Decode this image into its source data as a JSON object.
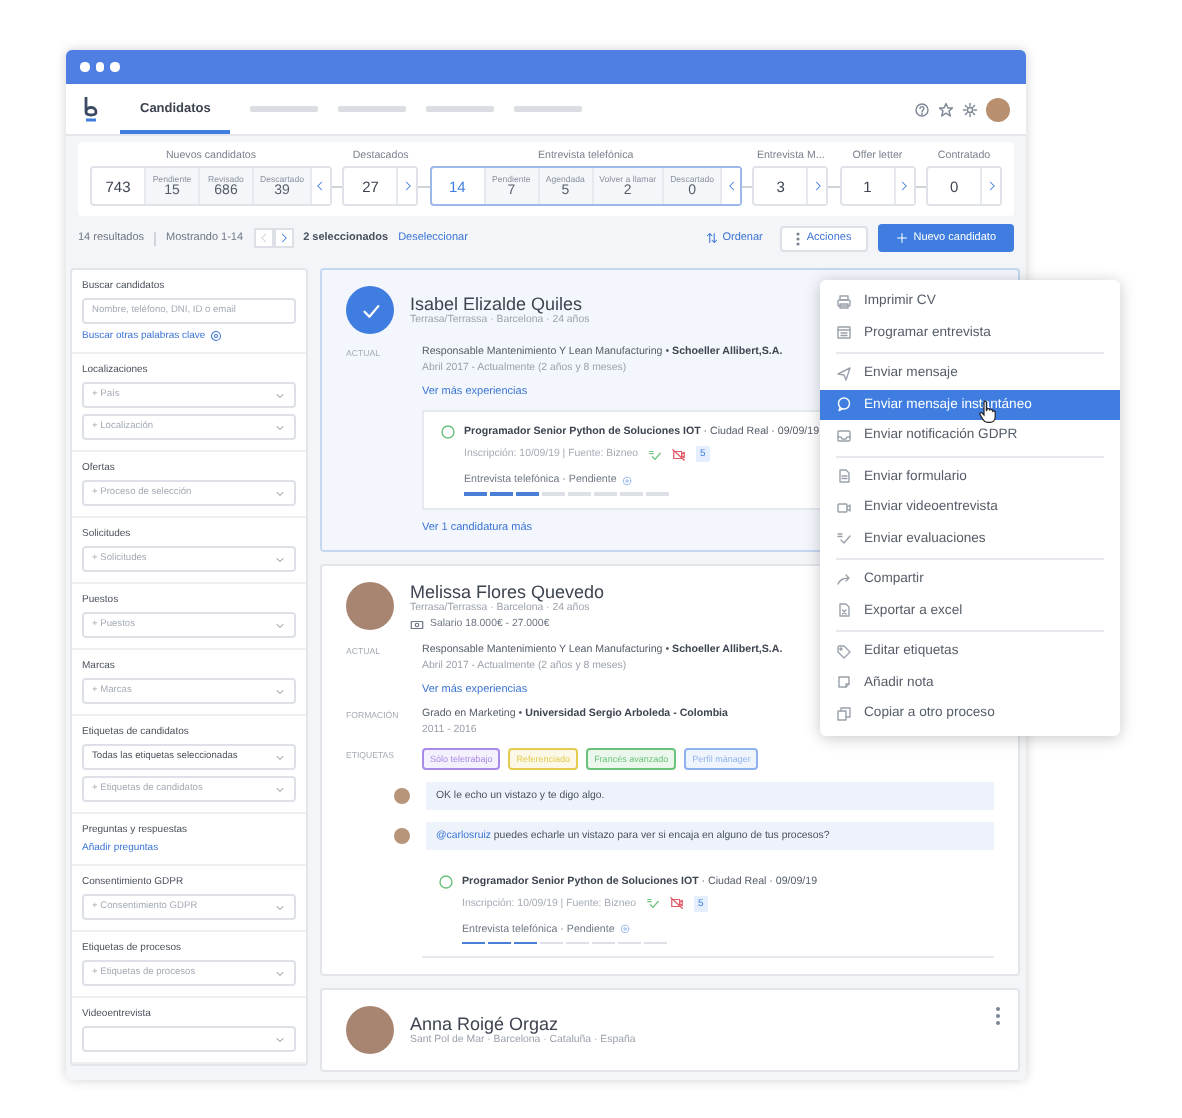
{
  "nav": {
    "tabs": [
      {
        "label": "Candidatos",
        "selected": true
      }
    ]
  },
  "pipeline": {
    "stages": [
      {
        "kind": "group",
        "title": "Nuevos candidatos",
        "total": "743",
        "selected": false,
        "subs": [
          {
            "label": "Pendiente",
            "count": "15"
          },
          {
            "label": "Revisado",
            "count": "686"
          },
          {
            "label": "Descartado",
            "count": "39"
          }
        ]
      },
      {
        "kind": "single",
        "title": "Destacados",
        "total": "27",
        "selected": false
      },
      {
        "kind": "group",
        "title": "Entrevista telefónica",
        "total": "14",
        "selected": true,
        "subs": [
          {
            "label": "Pendiente",
            "count": "7"
          },
          {
            "label": "Agendada",
            "count": "5"
          },
          {
            "label": "Volver a llamar",
            "count": "2"
          },
          {
            "label": "Descartado",
            "count": "0"
          }
        ]
      },
      {
        "kind": "single",
        "title": "Entrevista M...",
        "total": "3",
        "selected": false
      },
      {
        "kind": "single",
        "title": "Offer letter",
        "total": "1",
        "selected": false
      },
      {
        "kind": "single",
        "title": "Contratado",
        "total": "0",
        "selected": false
      }
    ]
  },
  "toolbar": {
    "results": "14 resultados",
    "showing": "Mostrando 1-14",
    "selected_count": "2 seleccionados",
    "deselect": "Deseleccionar",
    "sort": "Ordenar",
    "actions": "Acciones",
    "new_candidate": "Nuevo candidato"
  },
  "filters": [
    {
      "title": "Buscar candidatos",
      "fields": [
        {
          "kind": "input",
          "placeholder": "Nombre, teléfono, DNI, ID o email"
        }
      ],
      "link": {
        "text": "Buscar otras palabras clave",
        "kind": "help"
      }
    },
    {
      "title": "Localizaciones",
      "fields": [
        {
          "kind": "select",
          "placeholder": "+ País"
        },
        {
          "kind": "select",
          "placeholder": "+ Localización"
        }
      ]
    },
    {
      "title": "Ofertas",
      "fields": [
        {
          "kind": "select",
          "placeholder": "+ Proceso de selección"
        }
      ]
    },
    {
      "title": "Solicitudes",
      "fields": [
        {
          "kind": "select",
          "placeholder": "+ Solicitudes"
        }
      ]
    },
    {
      "title": "Puestos",
      "fields": [
        {
          "kind": "select",
          "placeholder": "+ Puestos"
        }
      ]
    },
    {
      "title": "Marcas",
      "fields": [
        {
          "kind": "select",
          "placeholder": "+ Marcas"
        }
      ]
    },
    {
      "title": "Etiquetas de candidatos",
      "fields": [
        {
          "kind": "select",
          "value": "Todas las etiquetas seleccionadas"
        },
        {
          "kind": "select",
          "placeholder": "+ Etiquetas de candidatos"
        }
      ]
    },
    {
      "title": "Preguntas y respuestas",
      "link": {
        "text": "Añadir preguntas",
        "kind": "plain"
      }
    },
    {
      "title": "Consentimiento GDPR",
      "fields": [
        {
          "kind": "select",
          "placeholder": "+ Consentimiento GDPR"
        }
      ]
    },
    {
      "title": "Etiquetas de procesos",
      "fields": [
        {
          "kind": "select",
          "placeholder": "+ Etiquetas de procesos"
        }
      ]
    },
    {
      "title": "Videoentrevista",
      "fields": [
        {
          "kind": "select"
        }
      ]
    }
  ],
  "candidates": [
    {
      "name": "Isabel Elizalde Quiles",
      "selected": true,
      "location": "Terrasa/Terrassa · Barcelona · 24 años",
      "experience": {
        "label": "ACTUAL",
        "line": "Responsable Mantenimiento Y Lean Manufacturing  •  **Schoeller Allibert,S.A.**",
        "dates": "Abril 2017 - Actualmente (2 años y 8 meses)"
      },
      "more_link": "Ver más experiencias",
      "applications": [
        {
          "line": "**Programador Senior Python de Soluciones IOT** · Ciudad Real · 09/09/19",
          "meta": "Inscripción: 10/09/19 | Fuente: Bizneo",
          "badge": "5",
          "stage": "Entrevista telefónica · Pendiente",
          "level": 0.375
        }
      ],
      "footer_link": "Ver 1 candidatura más"
    },
    {
      "name": "Melissa Flores Quevedo",
      "selected": false,
      "location": "Terrasa/Terrassa · Barcelona · 24 años",
      "salary": "Salario 18.000€ - 27.000€",
      "experience": {
        "label": "ACTUAL",
        "line": "Responsable Mantenimiento Y Lean Manufacturing  •  **Schoeller Allibert,S.A.**",
        "dates": "Abril 2017 - Actualmente (2 años y 8 meses)"
      },
      "more_link": "Ver más experiencias",
      "education": {
        "label": "FORMACIÓN",
        "line": "Grado en Marketing  •  **Universidad Sergio Arboleda - Colombia**",
        "dates": "2011 - 2016"
      },
      "tags_label": "ETIQUETAS",
      "tags": [
        {
          "text": "Sólo teletrabajo",
          "color": "#a98be8"
        },
        {
          "text": "Referenciado",
          "color": "#e3cb4f"
        },
        {
          "text": "Francés avanzado",
          "color": "#6cc27a"
        },
        {
          "text": "Perfil mánager",
          "color": "#8fb2ee"
        }
      ],
      "comments": [
        {
          "text": "OK le echo un vistazo y te digo algo."
        },
        {
          "mention": "@carlosruiz",
          "text": "puedes echarle un vistazo para ver si encaja en alguno de tus procesos?"
        }
      ],
      "applications": [
        {
          "line": "**Programador Senior Python de Soluciones IOT** · Ciudad Real · 09/09/19",
          "meta": "Inscripción: 10/09/19 | Fuente: Bizneo",
          "badge": "5",
          "stage": "Entrevista telefónica · Pendiente",
          "level": 0.375
        }
      ]
    },
    {
      "name": "Anna Roigé Orgaz",
      "selected": false,
      "location": "Sant Pol de Mar · Barcelona · Cataluña · España"
    }
  ],
  "menu": {
    "groups": [
      {
        "items": [
          {
            "kind": "print",
            "label": "Imprimir CV",
            "selected": false
          },
          {
            "kind": "calendar",
            "label": "Programar entrevista",
            "selected": false
          }
        ]
      },
      {
        "items": [
          {
            "kind": "send",
            "label": "Enviar mensaje",
            "selected": false
          },
          {
            "kind": "chat",
            "label": "Enviar mensaje instantáneo",
            "selected": true
          },
          {
            "kind": "inbox",
            "label": "Enviar notificación GDPR",
            "selected": false
          }
        ]
      },
      {
        "items": [
          {
            "kind": "form",
            "label": "Enviar formulario",
            "selected": false
          },
          {
            "kind": "video",
            "label": "Enviar videoentrevista",
            "selected": false
          },
          {
            "kind": "evaluation",
            "label": "Enviar evaluaciones",
            "selected": false
          }
        ]
      },
      {
        "items": [
          {
            "kind": "share",
            "label": "Compartir",
            "selected": false
          },
          {
            "kind": "excel",
            "label": "Exportar a excel",
            "selected": false
          }
        ]
      },
      {
        "items": [
          {
            "kind": "tag",
            "label": "Editar etiquetas",
            "selected": false
          },
          {
            "kind": "note",
            "label": "Añadir nota",
            "selected": false
          },
          {
            "kind": "copy",
            "label": "Copiar a otro proceso",
            "selected": false
          }
        ]
      }
    ]
  }
}
